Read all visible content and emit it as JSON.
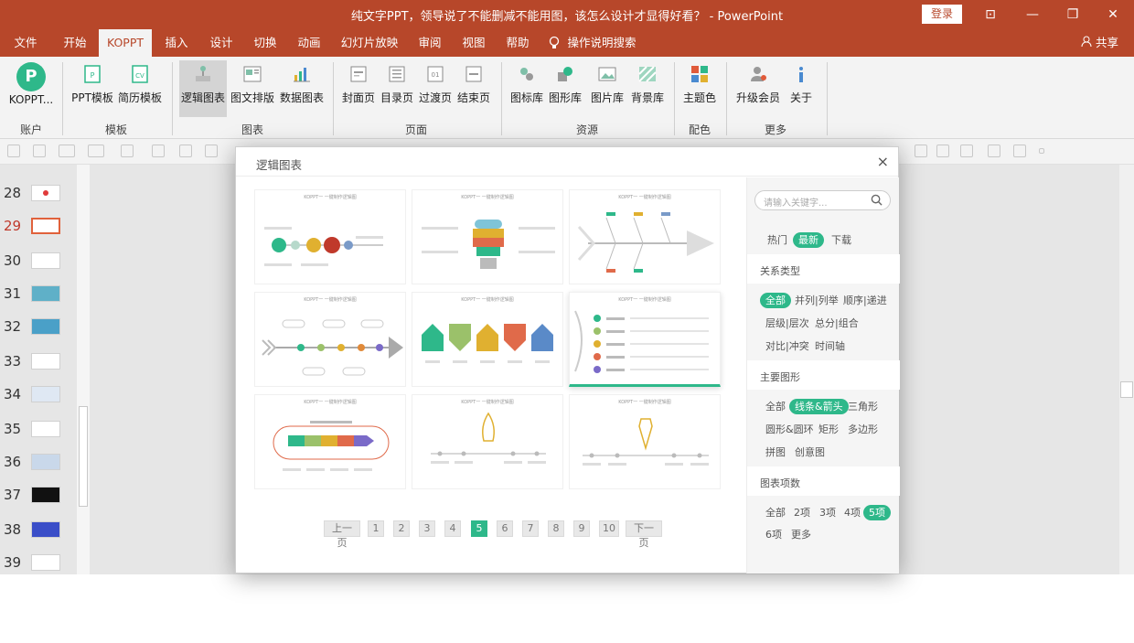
{
  "window": {
    "title": "纯文字PPT，领导说了不能删减不能用图，该怎么设计才显得好看？ - PowerPoint",
    "login_label": "登录",
    "buttons": [
      "⊡",
      "—",
      "❐",
      "✕"
    ]
  },
  "menu": {
    "tabs": [
      "文件",
      "开始",
      "KOPPT",
      "插入",
      "设计",
      "切换",
      "动画",
      "幻灯片放映",
      "审阅",
      "视图",
      "帮助"
    ],
    "active_tab": "KOPPT",
    "help_search": "操作说明搜索",
    "share": "共享"
  },
  "ribbon": {
    "account_btn": "KOPPT...",
    "groups": [
      {
        "label": "账户"
      },
      {
        "label": "模板"
      },
      {
        "label": "图表"
      },
      {
        "label": "页面"
      },
      {
        "label": "资源"
      },
      {
        "label": "配色"
      },
      {
        "label": "更多"
      }
    ],
    "buttons": {
      "ppt_template": "PPT模板",
      "resume_template": "简历模板",
      "logic_chart": "逻辑图表",
      "text_layout": "图文排版",
      "data_chart": "数据图表",
      "cover_page": "封面页",
      "toc_page": "目录页",
      "transition_page": "过渡页",
      "end_page": "结束页",
      "icon_lib": "图标库",
      "shape_lib": "图形库",
      "picture_lib": "图片库",
      "background_lib": "背景库",
      "theme_color": "主题色",
      "upgrade": "升级会员",
      "about": "关于"
    }
  },
  "slides": {
    "numbers": [
      "28",
      "29",
      "30",
      "31",
      "32",
      "33",
      "34",
      "35",
      "36",
      "37",
      "38",
      "39"
    ],
    "active": "29"
  },
  "modal": {
    "title": "逻辑图表",
    "close": "×",
    "card_caption": "KOPPT一 一键制作逻辑图",
    "pager": {
      "prev": "上一页",
      "pages": [
        "1",
        "2",
        "3",
        "4",
        "5",
        "6",
        "7",
        "8",
        "9",
        "10"
      ],
      "active": "5",
      "next": "下一页"
    },
    "search_placeholder": "请输入关键字...",
    "sort_tabs": [
      "热门",
      "最新",
      "下载"
    ],
    "sort_active": "最新",
    "relation": {
      "heading": "关系类型",
      "items": [
        "全部",
        "并列|列举",
        "顺序|递进",
        "层级|层次",
        "总分|组合",
        "对比|冲突",
        "时间轴"
      ],
      "active": "全部"
    },
    "shape": {
      "heading": "主要图形",
      "items": [
        "全部",
        "线条&箭头",
        "三角形",
        "圆形&圆环",
        "矩形",
        "多边形",
        "拼图",
        "创意图"
      ],
      "active": "线条&箭头"
    },
    "count": {
      "heading": "图表项数",
      "items": [
        "全部",
        "2项",
        "3项",
        "4项",
        "5项",
        "6项",
        "更多"
      ],
      "active": "5项"
    }
  }
}
